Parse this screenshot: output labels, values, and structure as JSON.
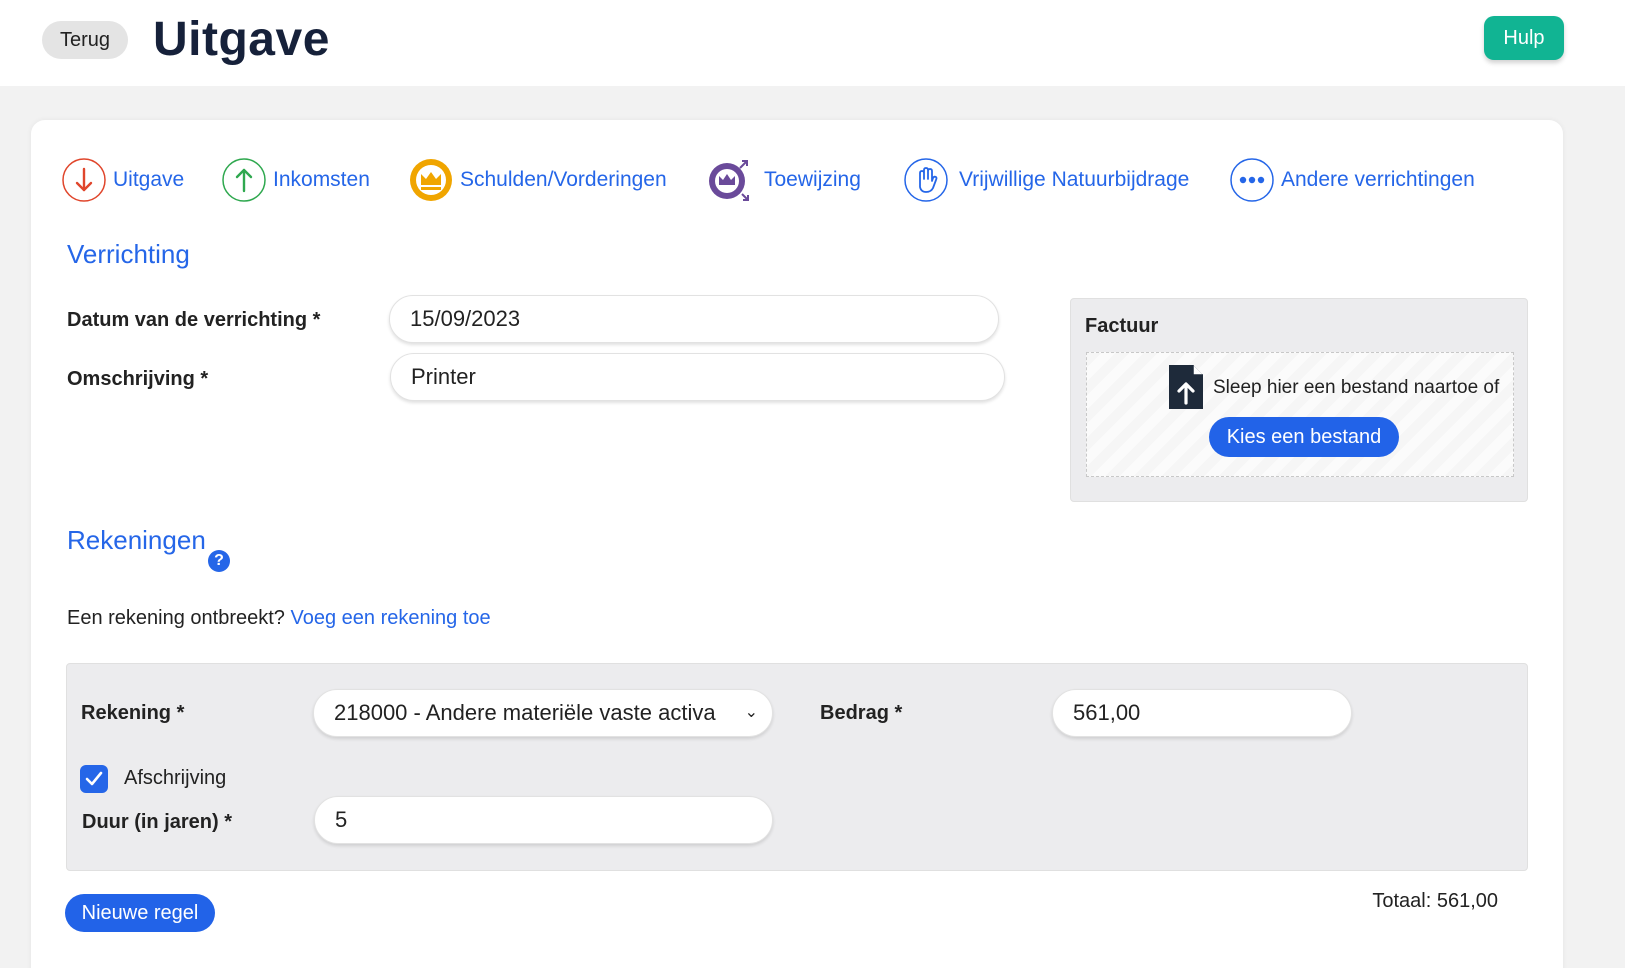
{
  "header": {
    "back_label": "Terug",
    "title": "Uitgave",
    "help_label": "Hulp"
  },
  "types": [
    {
      "label": "Uitgave",
      "icon": "arrow-down-icon",
      "color": "#e0462c"
    },
    {
      "label": "Inkomsten",
      "icon": "arrow-up-icon",
      "color": "#2fa84f"
    },
    {
      "label": "Schulden/Vorderingen",
      "icon": "crown-icon",
      "color": "#f0a500"
    },
    {
      "label": "Toewijzing",
      "icon": "crown-transfer-icon",
      "color": "#6a4a9a"
    },
    {
      "label": "Vrijwillige Natuurbijdrage",
      "icon": "hand-icon",
      "color": "#2566e8"
    },
    {
      "label": "Andere verrichtingen",
      "icon": "more-icon",
      "color": "#2566e8"
    }
  ],
  "operation": {
    "section_title": "Verrichting",
    "date_label": "Datum van de verrichting *",
    "date_value": "15/09/2023",
    "description_label": "Omschrijving *",
    "description_value": "Printer"
  },
  "invoice": {
    "title": "Factuur",
    "drop_text": "Sleep hier een bestand naartoe of",
    "choose_label": "Kies een bestand"
  },
  "accounts": {
    "section_title": "Rekeningen",
    "help_icon": "question-icon",
    "missing_text": "Een rekening ontbreekt?",
    "add_link": "Voeg een rekening toe",
    "line": {
      "account_label": "Rekening *",
      "account_value": "218000 -  Andere materiële vaste activa",
      "amount_label": "Bedrag *",
      "amount_value": "561,00",
      "depreciation_label": "Afschrijving",
      "depreciation_checked": true,
      "duration_label": "Duur (in jaren) *",
      "duration_value": "5"
    },
    "new_line_label": "Nieuwe regel",
    "total_label": "Totaal: 561,00"
  },
  "colors": {
    "accent": "#2566e8",
    "help_button": "#11b493",
    "page_background": "#f2f2f2",
    "panel_background": "#ececee"
  }
}
